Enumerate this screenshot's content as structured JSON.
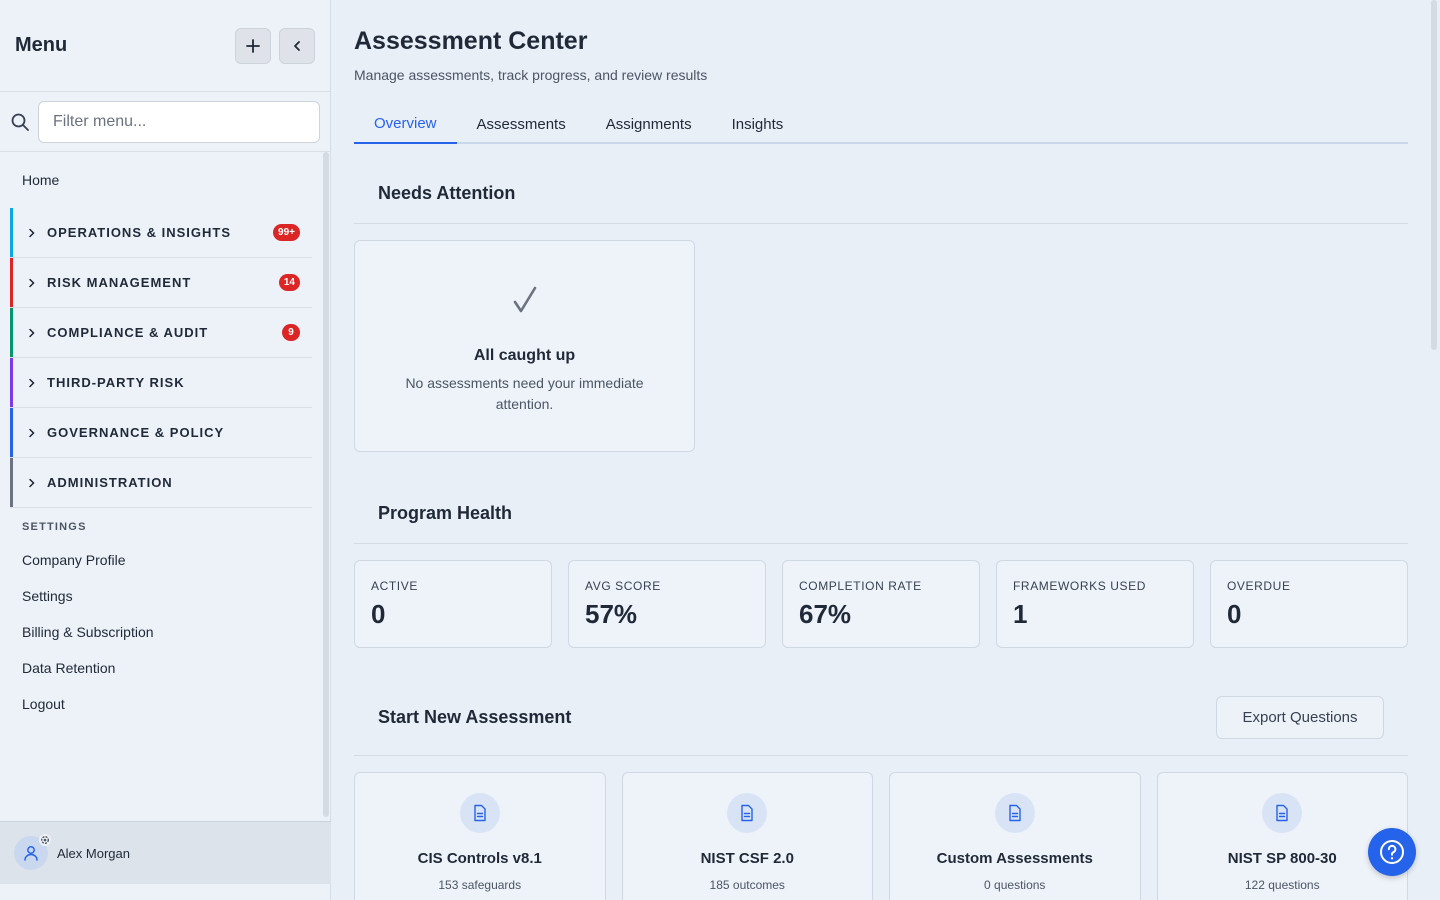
{
  "sidebar": {
    "title": "Menu",
    "filter_placeholder": "Filter menu...",
    "home": "Home",
    "groups": [
      {
        "label": "OPERATIONS & INSIGHTS",
        "badge": "99+",
        "color": "#0ea5e9"
      },
      {
        "label": "RISK MANAGEMENT",
        "badge": "14",
        "color": "#dc2626"
      },
      {
        "label": "COMPLIANCE & AUDIT",
        "badge": "9",
        "color": "#059669"
      },
      {
        "label": "THIRD-PARTY RISK",
        "badge": "",
        "color": "#7c3aed"
      },
      {
        "label": "GOVERNANCE & POLICY",
        "badge": "",
        "color": "#2563eb"
      },
      {
        "label": "ADMINISTRATION",
        "badge": "",
        "color": "#6b7280"
      }
    ],
    "settings_heading": "SETTINGS",
    "settings_items": [
      "Company Profile",
      "Settings",
      "Billing & Subscription",
      "Data Retention",
      "Logout"
    ],
    "user_name": "Alex Morgan"
  },
  "header": {
    "title": "Assessment Center",
    "subtitle": "Manage assessments, track progress, and review results"
  },
  "tabs": [
    "Overview",
    "Assessments",
    "Assignments",
    "Insights"
  ],
  "needs_attention": {
    "title": "Needs Attention",
    "empty_title": "All caught up",
    "empty_text": "No assessments need your immediate attention."
  },
  "program_health": {
    "title": "Program Health",
    "stats": [
      {
        "label": "ACTIVE",
        "value": "0"
      },
      {
        "label": "AVG SCORE",
        "value": "57%"
      },
      {
        "label": "COMPLETION RATE",
        "value": "67%"
      },
      {
        "label": "FRAMEWORKS USED",
        "value": "1"
      },
      {
        "label": "OVERDUE",
        "value": "0"
      }
    ]
  },
  "start_new": {
    "title": "Start New Assessment",
    "export_label": "Export Questions",
    "frameworks": [
      {
        "title": "CIS Controls v8.1",
        "sub": "153 safeguards"
      },
      {
        "title": "NIST CSF 2.0",
        "sub": "185 outcomes"
      },
      {
        "title": "Custom Assessments",
        "sub": "0 questions"
      },
      {
        "title": "NIST SP 800-30",
        "sub": "122 questions"
      }
    ]
  },
  "colors": {
    "accent": "#2563eb",
    "badge": "#dc2626"
  }
}
